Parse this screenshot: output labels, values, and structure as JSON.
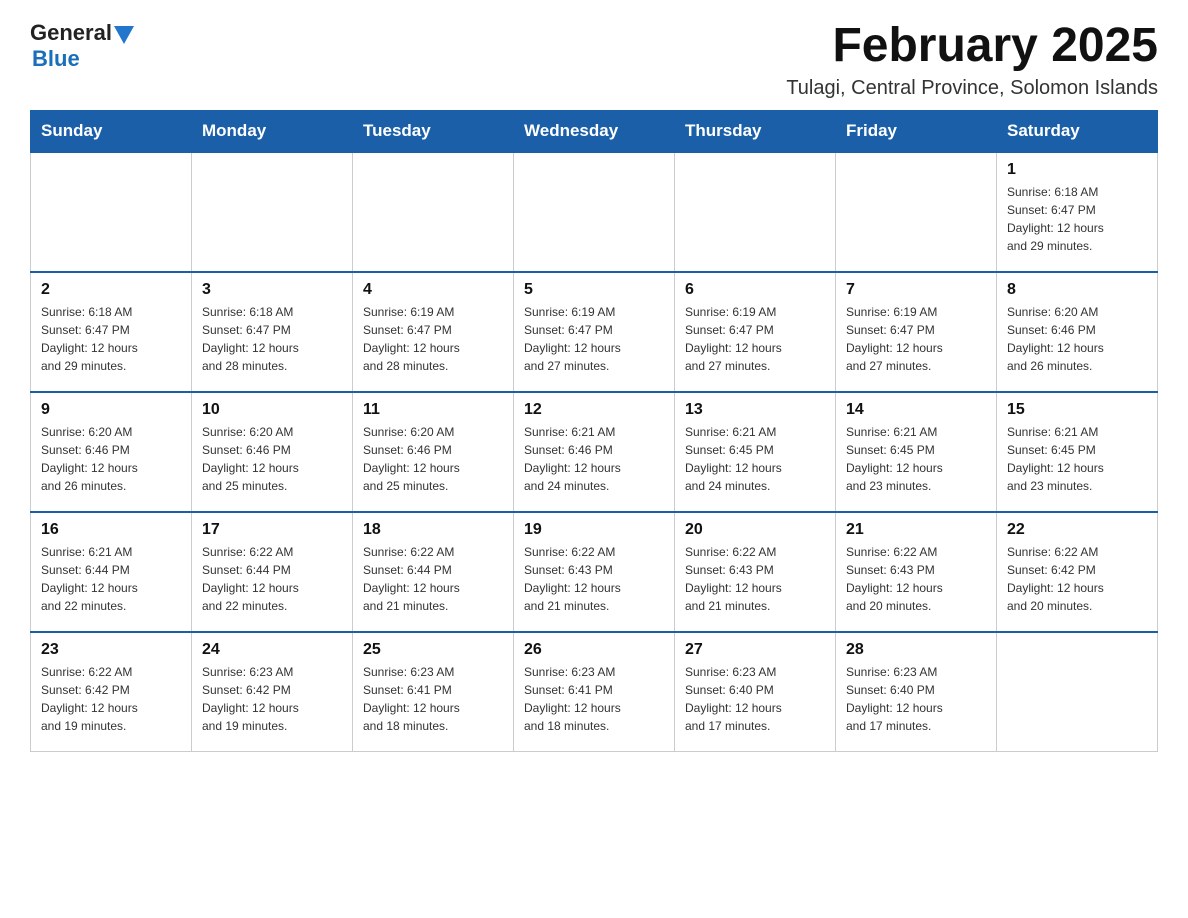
{
  "header": {
    "logo": {
      "text_general": "General",
      "text_blue": "Blue"
    },
    "title": "February 2025",
    "subtitle": "Tulagi, Central Province, Solomon Islands"
  },
  "days_of_week": [
    "Sunday",
    "Monday",
    "Tuesday",
    "Wednesday",
    "Thursday",
    "Friday",
    "Saturday"
  ],
  "weeks": [
    [
      {
        "day": "",
        "info": ""
      },
      {
        "day": "",
        "info": ""
      },
      {
        "day": "",
        "info": ""
      },
      {
        "day": "",
        "info": ""
      },
      {
        "day": "",
        "info": ""
      },
      {
        "day": "",
        "info": ""
      },
      {
        "day": "1",
        "info": "Sunrise: 6:18 AM\nSunset: 6:47 PM\nDaylight: 12 hours\nand 29 minutes."
      }
    ],
    [
      {
        "day": "2",
        "info": "Sunrise: 6:18 AM\nSunset: 6:47 PM\nDaylight: 12 hours\nand 29 minutes."
      },
      {
        "day": "3",
        "info": "Sunrise: 6:18 AM\nSunset: 6:47 PM\nDaylight: 12 hours\nand 28 minutes."
      },
      {
        "day": "4",
        "info": "Sunrise: 6:19 AM\nSunset: 6:47 PM\nDaylight: 12 hours\nand 28 minutes."
      },
      {
        "day": "5",
        "info": "Sunrise: 6:19 AM\nSunset: 6:47 PM\nDaylight: 12 hours\nand 27 minutes."
      },
      {
        "day": "6",
        "info": "Sunrise: 6:19 AM\nSunset: 6:47 PM\nDaylight: 12 hours\nand 27 minutes."
      },
      {
        "day": "7",
        "info": "Sunrise: 6:19 AM\nSunset: 6:47 PM\nDaylight: 12 hours\nand 27 minutes."
      },
      {
        "day": "8",
        "info": "Sunrise: 6:20 AM\nSunset: 6:46 PM\nDaylight: 12 hours\nand 26 minutes."
      }
    ],
    [
      {
        "day": "9",
        "info": "Sunrise: 6:20 AM\nSunset: 6:46 PM\nDaylight: 12 hours\nand 26 minutes."
      },
      {
        "day": "10",
        "info": "Sunrise: 6:20 AM\nSunset: 6:46 PM\nDaylight: 12 hours\nand 25 minutes."
      },
      {
        "day": "11",
        "info": "Sunrise: 6:20 AM\nSunset: 6:46 PM\nDaylight: 12 hours\nand 25 minutes."
      },
      {
        "day": "12",
        "info": "Sunrise: 6:21 AM\nSunset: 6:46 PM\nDaylight: 12 hours\nand 24 minutes."
      },
      {
        "day": "13",
        "info": "Sunrise: 6:21 AM\nSunset: 6:45 PM\nDaylight: 12 hours\nand 24 minutes."
      },
      {
        "day": "14",
        "info": "Sunrise: 6:21 AM\nSunset: 6:45 PM\nDaylight: 12 hours\nand 23 minutes."
      },
      {
        "day": "15",
        "info": "Sunrise: 6:21 AM\nSunset: 6:45 PM\nDaylight: 12 hours\nand 23 minutes."
      }
    ],
    [
      {
        "day": "16",
        "info": "Sunrise: 6:21 AM\nSunset: 6:44 PM\nDaylight: 12 hours\nand 22 minutes."
      },
      {
        "day": "17",
        "info": "Sunrise: 6:22 AM\nSunset: 6:44 PM\nDaylight: 12 hours\nand 22 minutes."
      },
      {
        "day": "18",
        "info": "Sunrise: 6:22 AM\nSunset: 6:44 PM\nDaylight: 12 hours\nand 21 minutes."
      },
      {
        "day": "19",
        "info": "Sunrise: 6:22 AM\nSunset: 6:43 PM\nDaylight: 12 hours\nand 21 minutes."
      },
      {
        "day": "20",
        "info": "Sunrise: 6:22 AM\nSunset: 6:43 PM\nDaylight: 12 hours\nand 21 minutes."
      },
      {
        "day": "21",
        "info": "Sunrise: 6:22 AM\nSunset: 6:43 PM\nDaylight: 12 hours\nand 20 minutes."
      },
      {
        "day": "22",
        "info": "Sunrise: 6:22 AM\nSunset: 6:42 PM\nDaylight: 12 hours\nand 20 minutes."
      }
    ],
    [
      {
        "day": "23",
        "info": "Sunrise: 6:22 AM\nSunset: 6:42 PM\nDaylight: 12 hours\nand 19 minutes."
      },
      {
        "day": "24",
        "info": "Sunrise: 6:23 AM\nSunset: 6:42 PM\nDaylight: 12 hours\nand 19 minutes."
      },
      {
        "day": "25",
        "info": "Sunrise: 6:23 AM\nSunset: 6:41 PM\nDaylight: 12 hours\nand 18 minutes."
      },
      {
        "day": "26",
        "info": "Sunrise: 6:23 AM\nSunset: 6:41 PM\nDaylight: 12 hours\nand 18 minutes."
      },
      {
        "day": "27",
        "info": "Sunrise: 6:23 AM\nSunset: 6:40 PM\nDaylight: 12 hours\nand 17 minutes."
      },
      {
        "day": "28",
        "info": "Sunrise: 6:23 AM\nSunset: 6:40 PM\nDaylight: 12 hours\nand 17 minutes."
      },
      {
        "day": "",
        "info": ""
      }
    ]
  ]
}
